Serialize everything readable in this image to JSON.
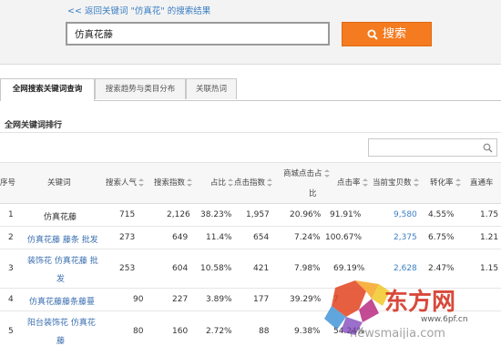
{
  "header": {
    "back_link": "<< 返回关键词 \"仿真花\" 的搜索结果",
    "search_value": "仿真花藤",
    "search_button": "搜索"
  },
  "tabs": [
    {
      "label": "全网搜索关键词查询"
    },
    {
      "label": "搜索趋势与类目分布"
    },
    {
      "label": "关联热词"
    }
  ],
  "section": {
    "title": "全网关键词排行"
  },
  "table": {
    "headers": {
      "index": "序号",
      "keyword": "关键词",
      "popularity": "搜索人气",
      "search_index": "搜索指数",
      "share": "占比",
      "click_index": "点击指数",
      "mall_click_1": "商城点击占",
      "mall_click_2": "比",
      "ctr": "点击率",
      "current_items": "当前宝贝数",
      "conversion": "转化率",
      "through": "直通车"
    },
    "rows": [
      {
        "index": "1",
        "keyword": [
          "仿真花藤"
        ],
        "popularity": "715",
        "search_index": "2,126",
        "share": "38.23%",
        "click_index": "1,957",
        "mall_click": "20.96%",
        "ctr": "91.91%",
        "items": "9,580",
        "conversion": "4.55%",
        "through": "1.75"
      },
      {
        "index": "2",
        "keyword": [
          "仿真花藤 藤条 批发"
        ],
        "popularity": "273",
        "search_index": "649",
        "share": "11.4%",
        "click_index": "654",
        "mall_click": "7.24%",
        "ctr": "100.67%",
        "items": "2,375",
        "conversion": "6.75%",
        "through": "1.21"
      },
      {
        "index": "3",
        "keyword": [
          "装饰花 仿真花藤 批",
          "发"
        ],
        "popularity": "253",
        "search_index": "604",
        "share": "10.58%",
        "click_index": "421",
        "mall_click": "7.98%",
        "ctr": "69.19%",
        "items": "2,628",
        "conversion": "2.47%",
        "through": "1.15"
      },
      {
        "index": "4",
        "keyword": [
          "仿真花藤藤条藤蔓"
        ],
        "popularity": "90",
        "search_index": "227",
        "share": "3.89%",
        "click_index": "177",
        "mall_click": "39.29%",
        "ctr": "7",
        "items": "",
        "conversion": "",
        "through": ""
      },
      {
        "index": "5",
        "keyword": [
          "阳台装饰花 仿真花",
          "藤"
        ],
        "popularity": "80",
        "search_index": "160",
        "share": "2.72%",
        "click_index": "88",
        "mall_click": "9.38%",
        "ctr": "54.24%",
        "items": "",
        "conversion": "",
        "through": ""
      }
    ]
  },
  "watermark": {
    "brand": "东方网",
    "site": "www.6pf.cn",
    "domain": "newsmaijia.com"
  },
  "colors": {
    "accent": "#f47b20",
    "link": "#3b7fc4"
  },
  "icons": [
    "search-icon",
    "magnifier-icon",
    "sort-icon"
  ]
}
